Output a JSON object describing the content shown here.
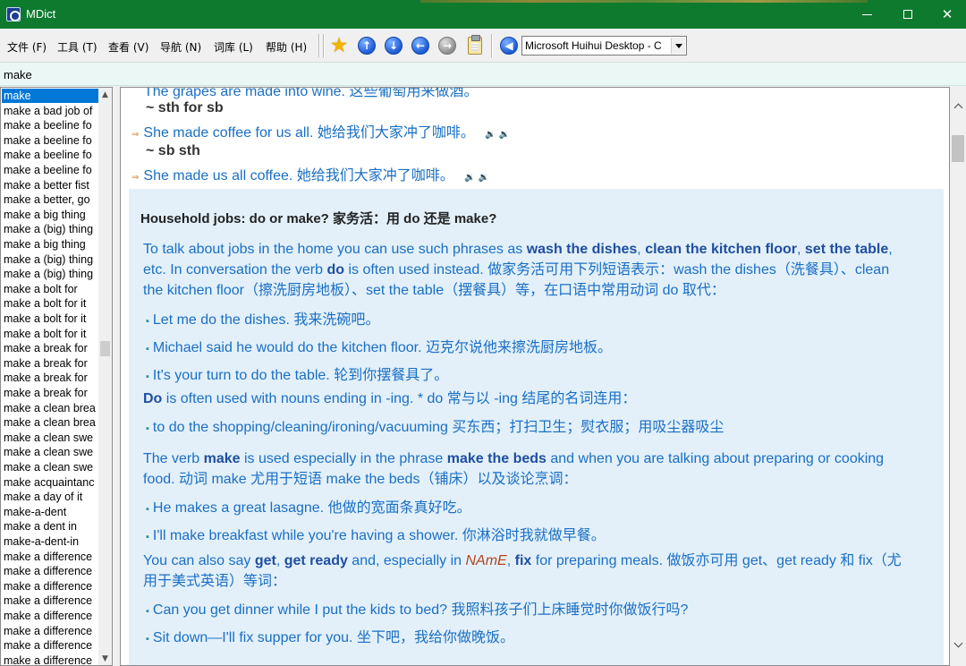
{
  "window": {
    "title": "MDict"
  },
  "menu": [
    {
      "label": "文件 (F)"
    },
    {
      "label": "工具 (T)"
    },
    {
      "label": "查看 (V)"
    },
    {
      "label": "导航 (N)"
    },
    {
      "label": "词库 (L)"
    },
    {
      "label": "帮助 (H)"
    }
  ],
  "toolbar": {
    "icons": [
      "star-icon",
      "arrow-up-icon",
      "arrow-down-icon",
      "arrow-left-icon",
      "arrow-right-icon",
      "clipboard-icon",
      "arrow-left-icon"
    ],
    "dictionary_selected": "Microsoft Huihui Desktop - C"
  },
  "search": {
    "value": "make"
  },
  "wordlist": [
    "make",
    "make a bad job of",
    "make a beeline fo",
    "make a beeline fo",
    "make a beeline fo",
    "make a beeline fo",
    "make a better fist",
    "make a better, go",
    "make a big thing",
    "make a (big) thing",
    "make a big thing",
    "make a (big) thing",
    "make a (big) thing",
    "make a bolt for",
    "make a bolt for it",
    "make a bolt for it",
    "make a bolt for it",
    "make a break for",
    "make a break for",
    "make a break for",
    "make a break for",
    "make a clean brea",
    "make a clean brea",
    "make a clean swe",
    "make a clean swe",
    "make a clean swe",
    "make acquaintanc",
    "make a day of it",
    "make-a-dent",
    "make a dent in",
    "make-a-dent-in",
    "make a difference",
    "make a difference",
    "make a difference",
    "make a difference",
    "make a difference",
    "make a difference",
    "make a difference",
    "make a difference"
  ],
  "entry": {
    "cut_top": "The grapes are made into wine. 这些葡萄用来做酒。",
    "pattern1": "~ sth for sb",
    "example1": "She made coffee for us all. 她给我们大家冲了咖啡。",
    "pattern2": "~ sb sth",
    "example2": "She made us all coffee. 她给我们大家冲了咖啡。",
    "note": {
      "title": "Household jobs: do or make? 家务活：用 do 还是 make?",
      "p1_a": "To talk about jobs in the home you can use such phrases as ",
      "p1_b1": "wash the dishes",
      "p1_c": ", ",
      "p1_b2": "clean the kitchen floor",
      "p1_d": ", ",
      "p1_b3": "set the table",
      "p1_e": ",",
      "p1_line2_a": "etc. In conversation the verb ",
      "p1_line2_b": "do",
      "p1_line2_c": " is often used instead. 做家务活可用下列短语表示：wash the dishes（洗餐具）、clean",
      "p1_line3": "the kitchen floor（擦洗厨房地板）、set the table（摆餐具）等，在口语中常用动词 do 取代：",
      "ex1": "Let me do the dishes. 我来洗碗吧。",
      "ex2": "Michael said he would do the kitchen floor. 迈克尔说他来擦洗厨房地板。",
      "ex3": "It's your turn to do the table. 轮到你摆餐具了。",
      "p2_b": "Do",
      "p2_a": " is often used with nouns ending in -ing. * do 常与以 -ing 结尾的名词连用：",
      "ex4": "to do the shopping/cleaning/ironing/vacuuming 买东西；打扫卫生；熨衣服；用吸尘器吸尘",
      "p3_a": "The verb ",
      "p3_b1": "make",
      "p3_c": " is used especially in the phrase ",
      "p3_b2": "make the beds",
      "p3_d": " and when you are talking about preparing or cooking",
      "p3_line2": "food. 动词 make 尤用于短语 make the beds（铺床）以及谈论烹调：",
      "ex5": "He makes a great lasagne. 他做的宽面条真好吃。",
      "ex6": "I'll make breakfast while you're having a shower. 你淋浴时我就做早餐。",
      "p4_a": "You can also say ",
      "p4_b1": "get",
      "p4_c": ", ",
      "p4_b2": "get ready",
      "p4_d": " and, especially in ",
      "p4_i": "NAmE",
      "p4_e": ", ",
      "p4_b3": "fix",
      "p4_f": " for preparing meals. 做饭亦可用 get、get ready 和 fix（尤",
      "p4_line2": "用于美式英语）等词：",
      "ex7": "Can you get dinner while I put the kids to bed? 我照料孩子们上床睡觉时你做饭行吗?",
      "ex8": "Sit down—I'll fix supper for you. 坐下吧，我给你做晚饭。"
    }
  }
}
